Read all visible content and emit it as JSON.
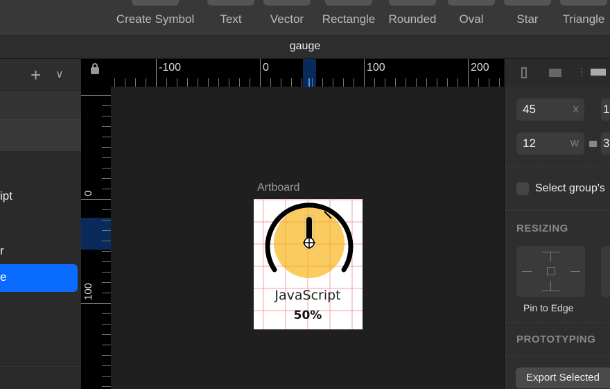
{
  "toolbar": {
    "items": [
      "Create Symbol",
      "Text",
      "Vector",
      "Rectangle",
      "Rounded",
      "Oval",
      "Star",
      "Triangle"
    ]
  },
  "window": {
    "title": "gauge"
  },
  "layers": {
    "items": [
      {
        "label": "ipt"
      },
      {
        "label": "r"
      },
      {
        "label": "e",
        "selected": true
      }
    ]
  },
  "ruler": {
    "top_labels": [
      "-100",
      "0",
      "100",
      "200"
    ],
    "left_labels": [
      "0",
      "100"
    ]
  },
  "canvas": {
    "artboard_label": "Artboard",
    "gauge_label": "JavaScript",
    "gauge_value": "50%",
    "gauge_percent": 50,
    "fill_color": "#f9c74f"
  },
  "inspector": {
    "x_value": "45",
    "x_label": "X",
    "w_value": "12",
    "w_label": "W",
    "y_value_partial": "1",
    "h_value_partial": "3",
    "select_group": "Select group's",
    "resizing": "RESIZING",
    "pin_to_edge": "Pin to Edge",
    "prototyping": "PROTOTYPING",
    "export_button": "Export Selected"
  },
  "colors": {
    "accent": "#0a6cff",
    "ruler_highlight": "#0b2a5c",
    "grid": "#f4a0a0"
  }
}
